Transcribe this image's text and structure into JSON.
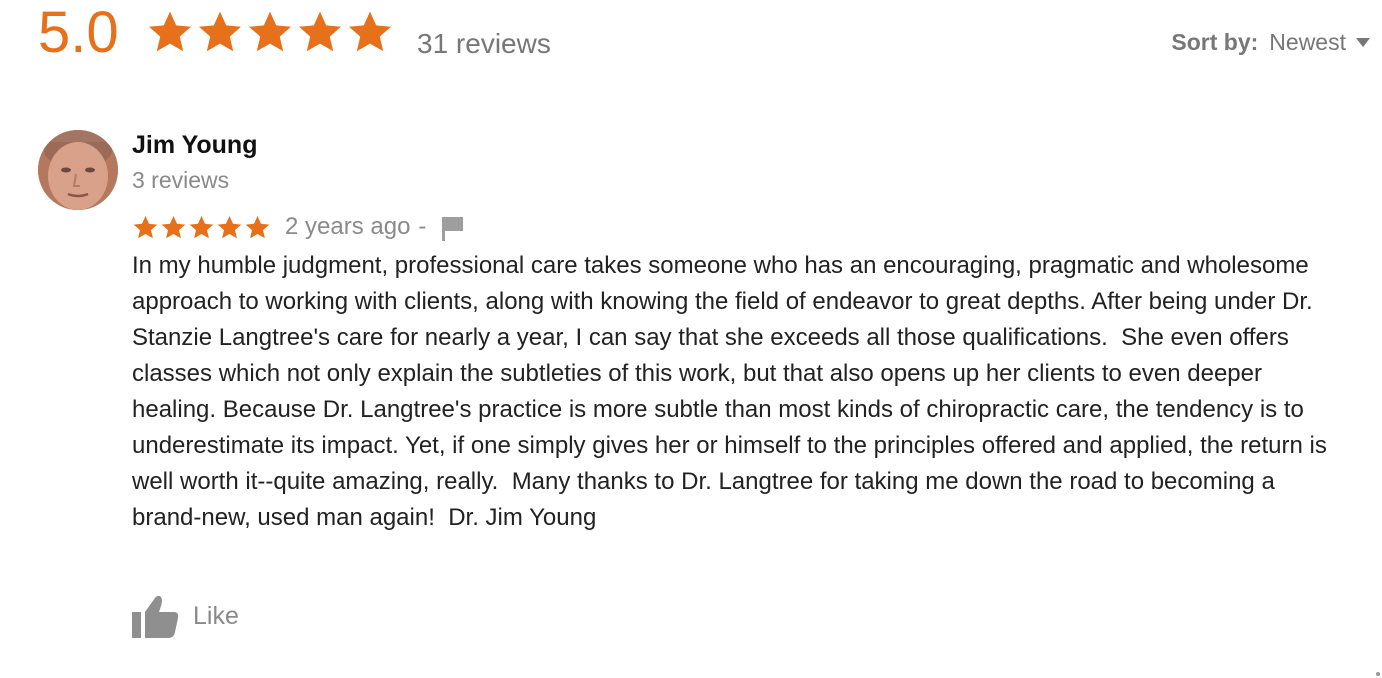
{
  "summary": {
    "score": "5.0",
    "rating": 5,
    "max_rating": 5,
    "reviews_count": "31 reviews",
    "star_color": "#e7711b"
  },
  "sort": {
    "label": "Sort by:",
    "value": "Newest",
    "icon": "caret-down-icon"
  },
  "review": {
    "author": "Jim Young",
    "author_reviews": "3 reviews",
    "rating": 5,
    "date": "2 years ago",
    "separator": "-",
    "flag_icon": "flag-icon",
    "text": "In my humble judgment, professional care takes someone who has an encouraging, pragmatic and wholesome approach to working with clients, along with knowing the field of endeavor to great depths. After being under Dr. Stanzie Langtree's care for nearly a year, I can say that she exceeds all those qualifications.  She even offers classes which not only explain the subtleties of this work, but that also opens up her clients to even deeper healing. Because Dr. Langtree's practice is more subtle than most kinds of chiropractic care, the tendency is to underestimate its impact. Yet, if one simply gives her or himself to the principles offered and applied, the return is well worth it--quite amazing, really.  Many thanks to Dr. Langtree for taking me down the road to becoming a brand-new, used man again!  Dr. Jim Young",
    "like_label": "Like",
    "like_icon": "thumbs-up-icon"
  },
  "colors": {
    "accent": "#e7711b",
    "muted_text": "#8a8a8a",
    "body_text": "#222222"
  }
}
